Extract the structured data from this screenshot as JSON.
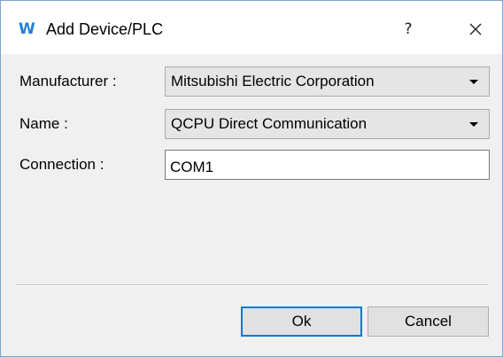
{
  "window": {
    "title": "Add Device/PLC",
    "icon_letter": "W",
    "help_label": "?"
  },
  "form": {
    "manufacturer": {
      "label": "Manufacturer :",
      "value": "Mitsubishi Electric Corporation"
    },
    "name": {
      "label": "Name :",
      "value": "QCPU Direct Communication"
    },
    "connection": {
      "label": "Connection :",
      "value": "COM1"
    }
  },
  "buttons": {
    "ok_label": "Ok",
    "cancel_label": "Cancel"
  },
  "colors": {
    "accent": "#0078d7",
    "icon": "#1f7fd8",
    "dialog_bg": "#f0f0f0"
  }
}
